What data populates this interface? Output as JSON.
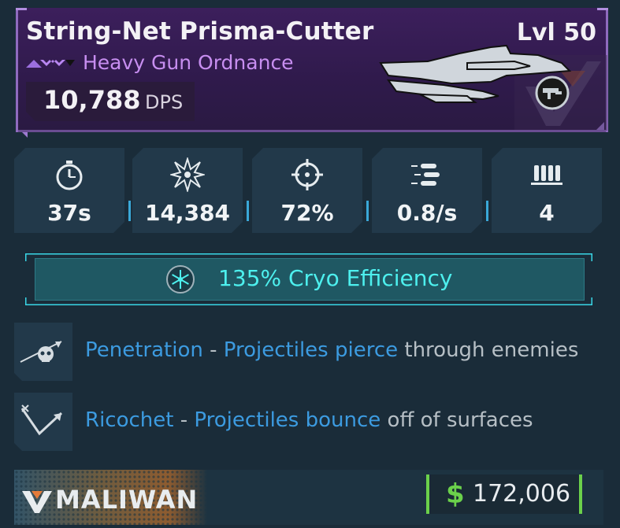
{
  "weapon": {
    "name": "String-Net Prisma-Cutter",
    "level": "Lvl 50",
    "type": "Heavy Gun Ordnance",
    "dps_value": "10,788",
    "dps_unit": "DPS",
    "rarity_color": "#9c6fe0"
  },
  "stats": [
    {
      "icon": "stopwatch-icon",
      "value": "37s"
    },
    {
      "icon": "explosion-icon",
      "value": "14,384"
    },
    {
      "icon": "crosshair-icon",
      "value": "72%"
    },
    {
      "icon": "bullets-icon",
      "value": "0.8/s"
    },
    {
      "icon": "ammo-magazine-icon",
      "value": "4"
    }
  ],
  "element": {
    "icon": "snowflake-icon",
    "text": "135% Cryo Efficiency",
    "color": "#4df0ee"
  },
  "perks": [
    {
      "icon": "penetration-skull-icon",
      "name": "Penetration",
      "separator": " - ",
      "highlight": "Projectiles pierce",
      "rest": " through enemies"
    },
    {
      "icon": "ricochet-arrow-icon",
      "name": "Ricochet",
      "separator": " - ",
      "highlight": "Projectiles bounce",
      "rest": " off of surfaces"
    }
  ],
  "footer": {
    "manufacturer": "MALIWAN",
    "currency_symbol": "$",
    "price": "172,006",
    "price_color": "#6bd14b"
  }
}
